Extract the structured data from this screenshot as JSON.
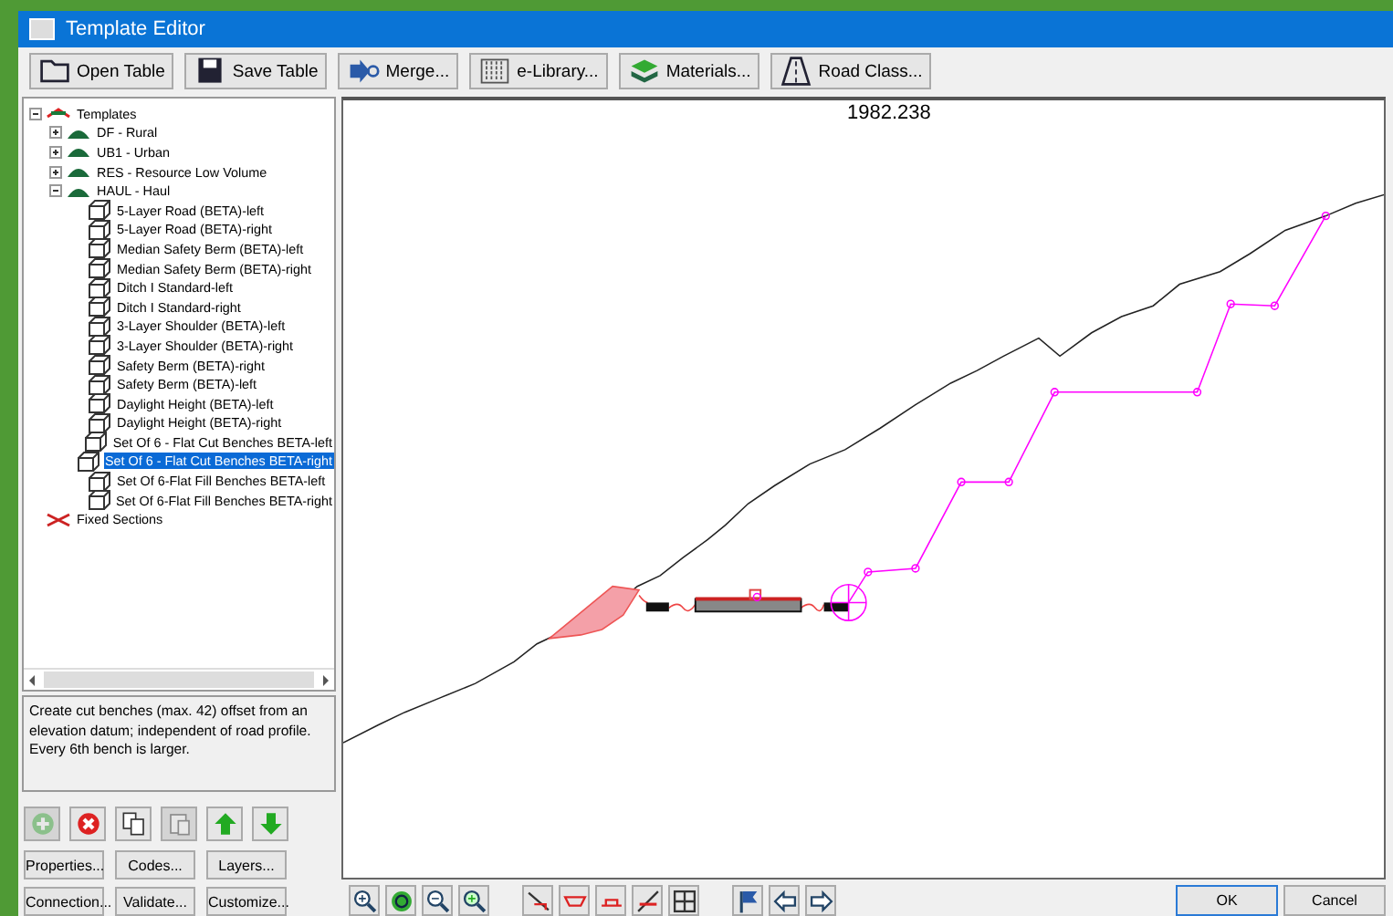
{
  "window": {
    "title": "Template Editor"
  },
  "toolbar": [
    {
      "label": "Open Table",
      "kind": "folder"
    },
    {
      "label": "Save Table",
      "kind": "disk"
    },
    {
      "label": "Merge...",
      "kind": "merge"
    },
    {
      "label": "e-Library...",
      "kind": "library"
    },
    {
      "label": "Materials...",
      "kind": "layers"
    },
    {
      "label": "Road Class...",
      "kind": "road"
    }
  ],
  "tree": [
    {
      "label": "Templates",
      "kind": "root",
      "expanded": true,
      "selected": false,
      "children": [
        {
          "label": "DF - Rural",
          "kind": "group",
          "expanded": false,
          "selected": false
        },
        {
          "label": "UB1 - Urban",
          "kind": "group",
          "expanded": false,
          "selected": false
        },
        {
          "label": "RES - Resource Low Volume",
          "kind": "group",
          "expanded": false,
          "selected": false
        },
        {
          "label": "HAUL - Haul",
          "kind": "group",
          "expanded": true,
          "selected": false,
          "children": [
            {
              "label": "5-Layer Road (BETA)-left",
              "kind": "template",
              "selected": false
            },
            {
              "label": "5-Layer Road (BETA)-right",
              "kind": "template",
              "selected": false
            },
            {
              "label": "Median Safety Berm (BETA)-left",
              "kind": "template",
              "selected": false
            },
            {
              "label": "Median Safety Berm (BETA)-right",
              "kind": "template",
              "selected": false
            },
            {
              "label": "Ditch I Standard-left",
              "kind": "template",
              "selected": false
            },
            {
              "label": "Ditch I Standard-right",
              "kind": "template",
              "selected": false
            },
            {
              "label": "3-Layer Shoulder (BETA)-left",
              "kind": "template",
              "selected": false
            },
            {
              "label": "3-Layer Shoulder (BETA)-right",
              "kind": "template",
              "selected": false
            },
            {
              "label": "Safety Berm (BETA)-right",
              "kind": "template",
              "selected": false
            },
            {
              "label": "Safety Berm (BETA)-left",
              "kind": "template",
              "selected": false
            },
            {
              "label": "Daylight Height (BETA)-left",
              "kind": "template",
              "selected": false
            },
            {
              "label": "Daylight Height (BETA)-right",
              "kind": "template",
              "selected": false
            },
            {
              "label": "Set Of 6 - Flat Cut Benches BETA-left",
              "kind": "template",
              "selected": false
            },
            {
              "label": "Set Of 6 - Flat Cut Benches BETA-right",
              "kind": "template",
              "selected": true
            },
            {
              "label": "Set Of 6-Flat Fill Benches BETA-left",
              "kind": "template",
              "selected": false
            },
            {
              "label": "Set Of 6-Flat Fill Benches BETA-right",
              "kind": "template",
              "selected": false
            }
          ]
        }
      ]
    },
    {
      "label": "Fixed Sections",
      "kind": "fixed",
      "selected": false
    }
  ],
  "description": "Create cut benches (max. 42) offset from an elevation datum; independent of road profile. Every 6th bench is larger.",
  "icon_buttons": [
    {
      "kind": "add",
      "disabled": true
    },
    {
      "kind": "delete",
      "disabled": false
    },
    {
      "kind": "copy",
      "disabled": false
    },
    {
      "kind": "paste",
      "disabled": true
    },
    {
      "kind": "up",
      "disabled": false
    },
    {
      "kind": "down",
      "disabled": false
    }
  ],
  "action_buttons": [
    "Properties...",
    "Codes...",
    "Layers...",
    "Connection...",
    "Validate...",
    "Customize..."
  ],
  "canvas": {
    "station": "1982.238"
  },
  "view_tools": [
    {
      "kind": "zoom-in"
    },
    {
      "kind": "refresh"
    },
    {
      "kind": "zoom-out"
    },
    {
      "kind": "zoom-window"
    },
    {
      "kind": "gap"
    },
    {
      "kind": "slope-down"
    },
    {
      "kind": "ditch"
    },
    {
      "kind": "deck"
    },
    {
      "kind": "slope-up"
    },
    {
      "kind": "grid"
    },
    {
      "kind": "gap"
    },
    {
      "kind": "flag"
    },
    {
      "kind": "arrow-left"
    },
    {
      "kind": "arrow-right"
    }
  ],
  "dialog_buttons": [
    "OK",
    "Cancel"
  ]
}
